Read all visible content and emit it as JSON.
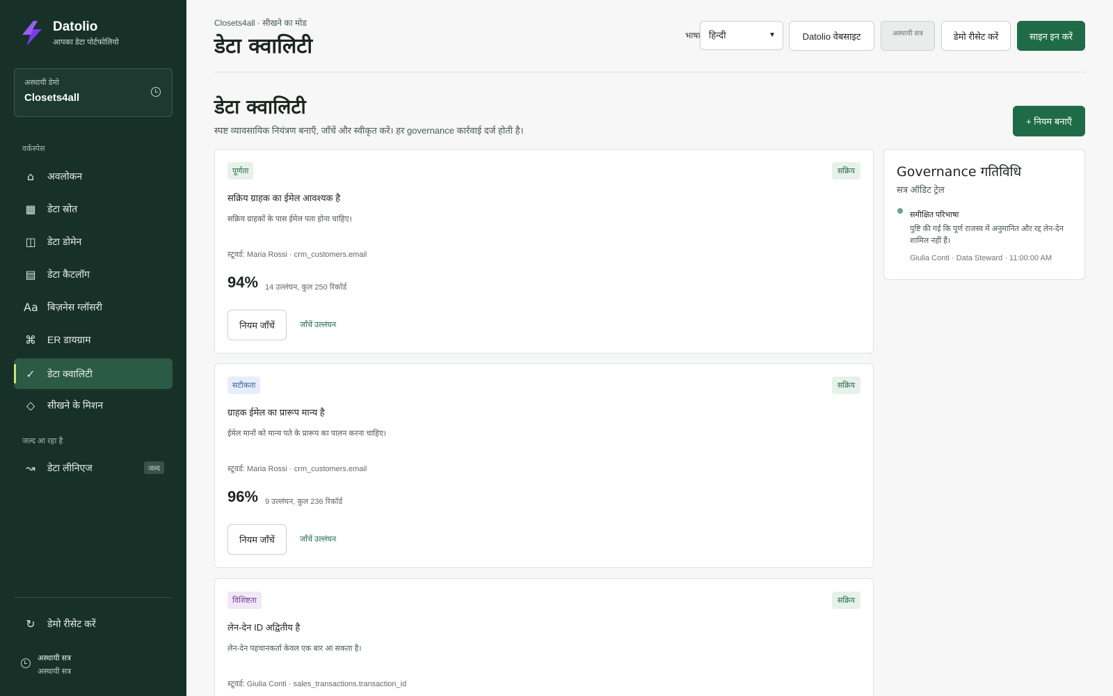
{
  "brand": {
    "name": "Datolio",
    "tagline": "आपका डेटा पोर्टफोलियो",
    "logo_color": "#7c3aed"
  },
  "demo": {
    "label": "अस्थायी डेमो",
    "name": "Closets4all",
    "icon": "clock-icon"
  },
  "sidebar": {
    "workspace_label": "वर्कस्पेस",
    "items": [
      {
        "label": "अवलोकन",
        "icon": "home-icon"
      },
      {
        "label": "डेटा स्रोत",
        "icon": "grid-icon"
      },
      {
        "label": "डेटा डोमेन",
        "icon": "columns-icon"
      },
      {
        "label": "डेटा कैटलॉग",
        "icon": "catalog-icon"
      },
      {
        "label": "बिज़नेस ग्लॉसरी",
        "icon": "glossary-icon"
      },
      {
        "label": "ER डायग्राम",
        "icon": "diagram-icon"
      },
      {
        "label": "डेटा क्वालिटी",
        "icon": "check-icon",
        "active": true
      },
      {
        "label": "सीखने के मिशन",
        "icon": "diamond-icon"
      }
    ],
    "coming_soon_label": "जल्द आ रहा है",
    "lineage": {
      "label": "डेटा लीनिएज",
      "badge": "जल्द",
      "icon": "lineage-icon"
    },
    "reset": {
      "label": "डेमो रीसेट करें",
      "icon": "refresh-icon"
    },
    "session": {
      "line1": "अस्थायी सत्र",
      "line2": "अस्थायी सत्र",
      "icon": "clock-icon"
    }
  },
  "header": {
    "breadcrumb": "Closets4all · सीखने का मोड",
    "title": "डेटा क्वालिटी",
    "language_label": "भाषा",
    "language_value": "हिन्दी",
    "website_button": "Datolio वेबसाइट",
    "temp_session_button": "अस्थायी सत्र",
    "reset_button": "डेमो रीसेट करें",
    "signin_button": "साइन इन करें",
    "accent": "#1f6b48"
  },
  "main": {
    "title": "डेटा क्वालिटी",
    "description": "स्पष्ट व्यावसायिक नियंत्रण बनाएँ, जाँचें और स्वीकृत करें। हर governance कार्रवाई दर्ज होती है।",
    "create_button": "+ नियम बनाएँ",
    "check_label": "नियम जाँचें",
    "violations_label": "जाँचें उल्लंघन",
    "rules": [
      {
        "tag": "पूर्णता",
        "status": "सक्रिय",
        "name": "सक्रिय ग्राहक का ईमेल आवश्यक है",
        "description": "सक्रिय ग्राहकों के पास ईमेल पता होना चाहिए।",
        "steward": "स्टूवर्ड: Maria Rossi · crm_customers.email",
        "score": "94%",
        "counts": "14 उल्लंघन, कुल 250 रिकॉर्ड"
      },
      {
        "tag": "सटीकता",
        "status": "सक्रिय",
        "name": "ग्राहक ईमेल का प्रारूप मान्य है",
        "description": "ईमेल मानों को मान्य पते के प्रारूप का पालन करना चाहिए।",
        "steward": "स्टूवर्ड: Maria Rossi · crm_customers.email",
        "score": "96%",
        "counts": "9 उल्लंघन, कुल 236 रिकॉर्ड"
      },
      {
        "tag": "विशिष्टता",
        "status": "सक्रिय",
        "name": "लेन-देन ID अद्वितीय है",
        "description": "लेन-देन पहचानकर्ता केवल एक बार आ सकता है।",
        "steward": "स्टूवर्ड: Giulia Conti · sales_transactions.transaction_id"
      }
    ]
  },
  "governance": {
    "title": "Governance गतिविधि",
    "subtitle": "सत्र ऑडिट ट्रेल",
    "event": {
      "title": "समीक्षित परिभाषा",
      "detail": "पुष्टि की गई कि पूर्ण राजस्व में अनुमानित और रद्द लेन-देन शामिल नहीं हैं।",
      "meta": "Giulia Conti · Data Steward · 11:00:00 AM"
    }
  }
}
